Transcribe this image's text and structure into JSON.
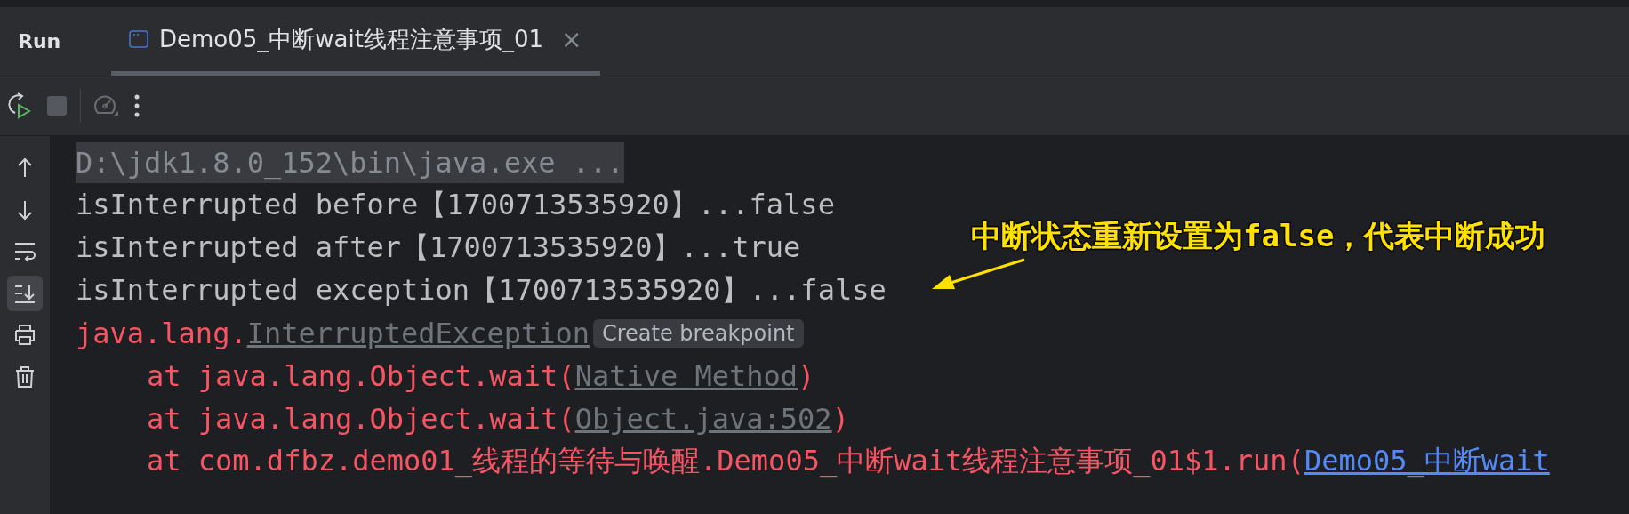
{
  "panel": {
    "title": "Run"
  },
  "tabs": [
    {
      "label": "Demo05_中断wait线程注意事项_01",
      "selected": true,
      "close": "×"
    }
  ],
  "toolbar": [
    {
      "kind": "rerun",
      "disabled": false
    },
    {
      "kind": "stop",
      "disabled": true
    },
    {
      "kind": "gauge",
      "disabled": true
    },
    {
      "kind": "more",
      "disabled": false
    }
  ],
  "side_tools": [
    {
      "kind": "up",
      "selected": false
    },
    {
      "kind": "down",
      "selected": false
    },
    {
      "kind": "wrap",
      "selected": false
    },
    {
      "kind": "scroll-end",
      "selected": true
    },
    {
      "kind": "print",
      "selected": false
    },
    {
      "kind": "trash",
      "selected": false
    }
  ],
  "console": {
    "lines": [
      {
        "indent": false,
        "segments": [
          {
            "kind": "command",
            "text": "D:\\jdk1.8.0_152\\bin\\java.exe ..."
          }
        ]
      },
      {
        "indent": false,
        "segments": [
          {
            "kind": "out",
            "text": "isInterrupted before【1700713535920】...false"
          }
        ]
      },
      {
        "indent": false,
        "segments": [
          {
            "kind": "out",
            "text": "isInterrupted after【1700713535920】...true"
          }
        ]
      },
      {
        "indent": false,
        "segments": [
          {
            "kind": "out",
            "text": "isInterrupted exception【1700713535920】...false"
          }
        ]
      },
      {
        "indent": false,
        "segments": [
          {
            "kind": "error",
            "text": "java.lang."
          },
          {
            "kind": "grey-link",
            "text": "InterruptedException"
          },
          {
            "kind": "hint",
            "text": "Create breakpoint"
          }
        ]
      },
      {
        "indent": true,
        "segments": [
          {
            "kind": "error",
            "text": "at java.lang.Object.wait("
          },
          {
            "kind": "grey-link",
            "text": "Native Method"
          },
          {
            "kind": "error",
            "text": ")"
          }
        ]
      },
      {
        "indent": true,
        "segments": [
          {
            "kind": "error",
            "text": "at java.lang.Object.wait("
          },
          {
            "kind": "grey-link",
            "text": "Object.java:502"
          },
          {
            "kind": "error",
            "text": ")"
          }
        ]
      },
      {
        "indent": true,
        "segments": [
          {
            "kind": "error",
            "text": "at com.dfbz.demo01_线程的等待与唤醒.Demo05_中断wait线程注意事项_01$1.run("
          },
          {
            "kind": "blue-link",
            "text": "Demo05_中断wait"
          }
        ]
      }
    ]
  },
  "annotation": {
    "text": "中断状态重新设置为false，代表中断成功"
  }
}
